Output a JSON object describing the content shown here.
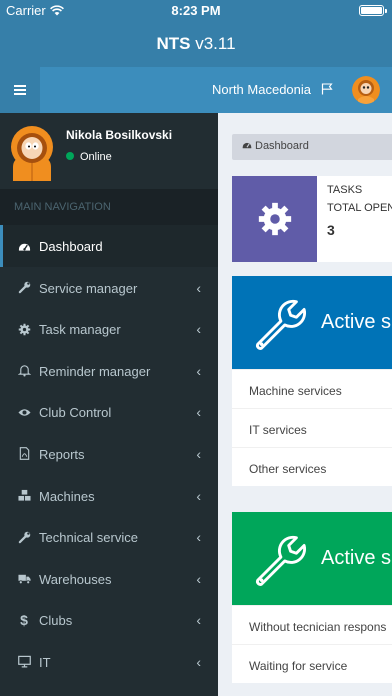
{
  "status_bar": {
    "carrier": "Carrier",
    "time": "8:23 PM"
  },
  "app": {
    "name": "NTS",
    "version": "v3.11"
  },
  "topnav": {
    "country": "North Macedonia"
  },
  "user": {
    "name": "Nikola Bosilkovski",
    "status": "Online"
  },
  "sidebar": {
    "header": "MAIN NAVIGATION",
    "items": [
      {
        "label": "Dashboard",
        "icon": "dashboard-icon",
        "active": true,
        "has_submenu": false
      },
      {
        "label": "Service manager",
        "icon": "wrench-icon",
        "active": false,
        "has_submenu": true
      },
      {
        "label": "Task manager",
        "icon": "gear-icon",
        "active": false,
        "has_submenu": true
      },
      {
        "label": "Reminder manager",
        "icon": "bell-icon",
        "active": false,
        "has_submenu": true
      },
      {
        "label": "Club Control",
        "icon": "eye-icon",
        "active": false,
        "has_submenu": true
      },
      {
        "label": "Reports",
        "icon": "file-pdf-icon",
        "active": false,
        "has_submenu": true
      },
      {
        "label": "Machines",
        "icon": "cubes-icon",
        "active": false,
        "has_submenu": true
      },
      {
        "label": "Technical service",
        "icon": "wrench-icon",
        "active": false,
        "has_submenu": true
      },
      {
        "label": "Warehouses",
        "icon": "truck-icon",
        "active": false,
        "has_submenu": true
      },
      {
        "label": "Clubs",
        "icon": "dollar-icon",
        "active": false,
        "has_submenu": true
      },
      {
        "label": "IT",
        "icon": "monitor-icon",
        "active": false,
        "has_submenu": true
      }
    ]
  },
  "breadcrumb": {
    "label": "Dashboard"
  },
  "tasks_box": {
    "line1": "TASKS",
    "line2": "TOTAL OPEN",
    "count": "3"
  },
  "active_services_card": {
    "title": "Active s",
    "rows": [
      "Machine services",
      "IT services",
      "Other services"
    ]
  },
  "active_second_card": {
    "title": "Active s",
    "rows": [
      "Without tecnician respons",
      "Waiting for service"
    ]
  },
  "colors": {
    "header": "#367fa9",
    "topnav": "#3c8dbc",
    "sidebar": "#222d32",
    "tasks_icon_bg": "#605ca8",
    "blue_card": "#0073b7",
    "green_card": "#00a65a",
    "online": "#00a65a"
  }
}
